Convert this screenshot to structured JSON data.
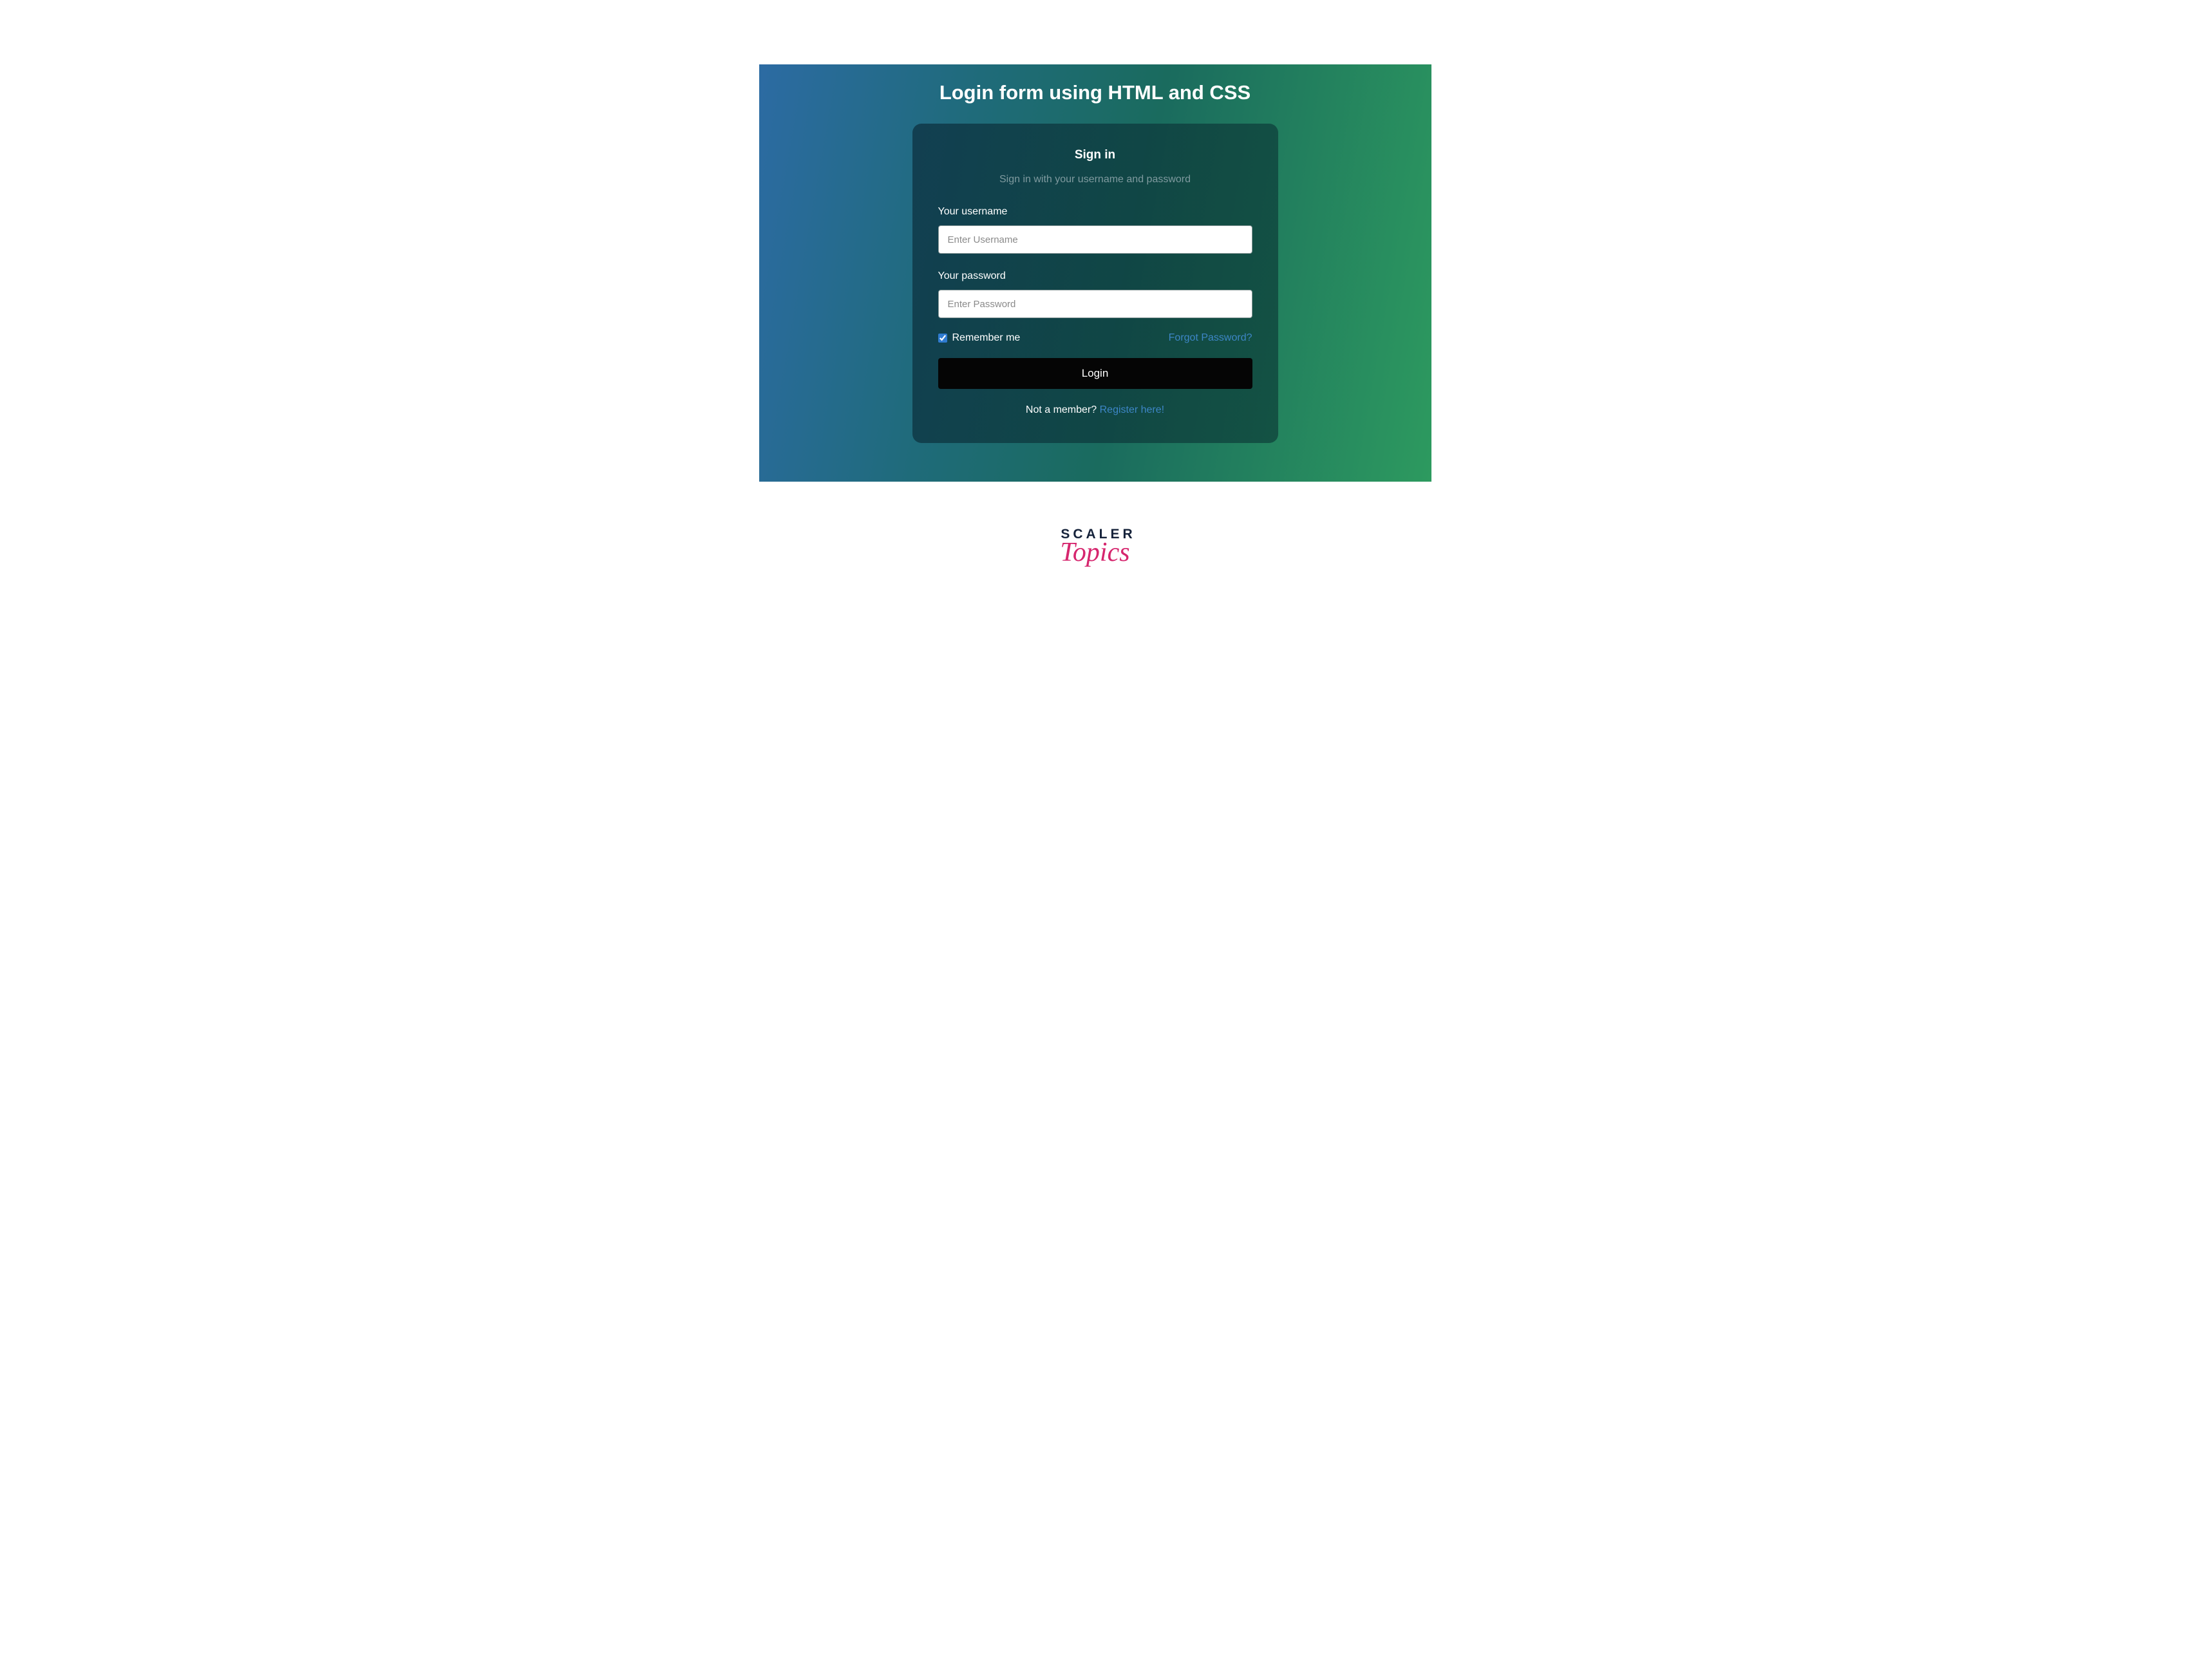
{
  "heading": "Login form using HTML and CSS",
  "card": {
    "title": "Sign in",
    "subtitle": "Sign in with your username and password",
    "username": {
      "label": "Your username",
      "placeholder": "Enter Username",
      "value": ""
    },
    "password": {
      "label": "Your password",
      "placeholder": "Enter Password",
      "value": ""
    },
    "remember": {
      "label": "Remember me",
      "checked": true
    },
    "forgot_label": "Forgot Password?",
    "login_button": "Login",
    "footer_prefix": "Not a member? ",
    "register_label": "Register here!"
  },
  "brand": {
    "line1": "SCALER",
    "line2": "Topics"
  }
}
